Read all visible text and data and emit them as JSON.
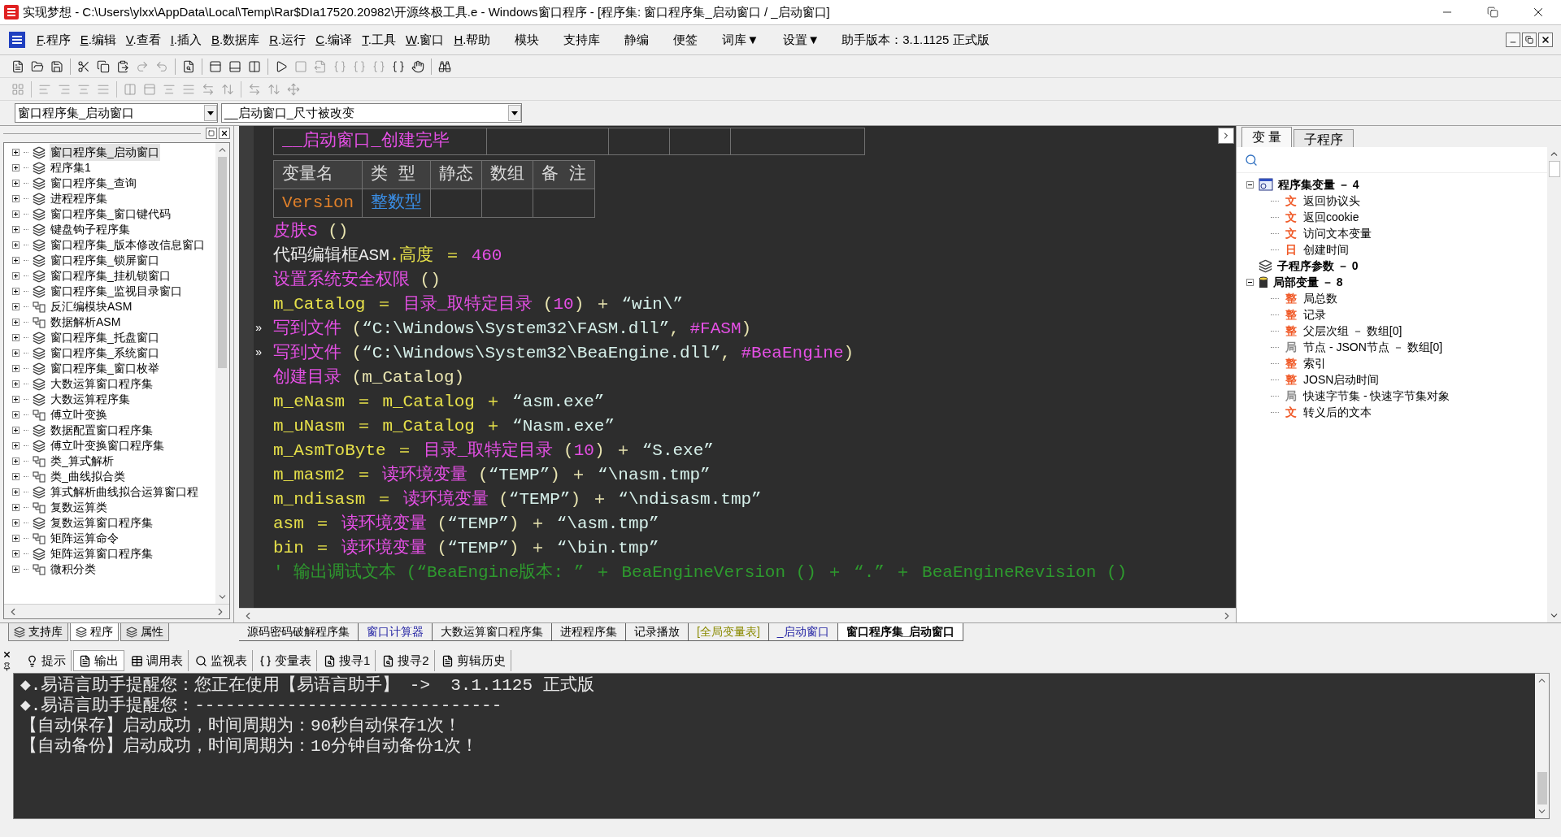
{
  "window": {
    "title": "实现梦想 - C:\\Users\\ylxx\\AppData\\Local\\Temp\\Rar$DIa17520.20982\\开源终极工具.e - Windows窗口程序 - [程序集: 窗口程序集_启动窗口 / _启动窗口]"
  },
  "menu": {
    "items": [
      {
        "label": "F.程序",
        "kind": "main"
      },
      {
        "label": "E.编辑",
        "kind": "main"
      },
      {
        "label": "V.查看",
        "kind": "main"
      },
      {
        "label": "I.插入",
        "kind": "main"
      },
      {
        "label": "B.数据库",
        "kind": "main"
      },
      {
        "label": "R.运行",
        "kind": "main"
      },
      {
        "label": "C.编译",
        "kind": "main"
      },
      {
        "label": "T.工具",
        "kind": "main"
      },
      {
        "label": "W.窗口",
        "kind": "main"
      },
      {
        "label": "H.帮助",
        "kind": "main"
      },
      {
        "label": "模块",
        "kind": "extra"
      },
      {
        "label": "支持库",
        "kind": "extra"
      },
      {
        "label": "静编",
        "kind": "extra"
      },
      {
        "label": "便签",
        "kind": "extra"
      },
      {
        "label": "词库▼",
        "kind": "extra"
      },
      {
        "label": "设置▼",
        "kind": "extra"
      }
    ],
    "version": "助手版本：3.1.1125 正式版"
  },
  "selectors": [
    {
      "value": "窗口程序集_启动窗口"
    },
    {
      "value": "__启动窗口_尺寸被改变"
    }
  ],
  "program_tree": {
    "items": [
      {
        "label": "窗口程序集_启动窗口",
        "kind": "assembly",
        "selected": true
      },
      {
        "label": "程序集1",
        "kind": "assembly",
        "selected": false
      },
      {
        "label": "窗口程序集_查询",
        "kind": "assembly",
        "selected": false
      },
      {
        "label": "进程程序集",
        "kind": "assembly",
        "selected": false
      },
      {
        "label": "窗口程序集_窗口键代码",
        "kind": "assembly",
        "selected": false
      },
      {
        "label": "键盘钩子程序集",
        "kind": "assembly",
        "selected": false
      },
      {
        "label": "窗口程序集_版本修改信息窗口",
        "kind": "assembly",
        "selected": false
      },
      {
        "label": "窗口程序集_锁屏窗口",
        "kind": "assembly",
        "selected": false
      },
      {
        "label": "窗口程序集_挂机锁窗口",
        "kind": "assembly",
        "selected": false
      },
      {
        "label": "窗口程序集_监视目录窗口",
        "kind": "assembly",
        "selected": false
      },
      {
        "label": "反汇编模块ASM",
        "kind": "class",
        "selected": false
      },
      {
        "label": "数据解析ASM",
        "kind": "class",
        "selected": false
      },
      {
        "label": "窗口程序集_托盘窗口",
        "kind": "assembly",
        "selected": false
      },
      {
        "label": "窗口程序集_系统窗口",
        "kind": "assembly",
        "selected": false
      },
      {
        "label": "窗口程序集_窗口枚举",
        "kind": "assembly",
        "selected": false
      },
      {
        "label": "大数运算窗口程序集",
        "kind": "assembly",
        "selected": false
      },
      {
        "label": "大数运算程序集",
        "kind": "assembly",
        "selected": false
      },
      {
        "label": "傅立叶变换",
        "kind": "class",
        "selected": false
      },
      {
        "label": "数据配置窗口程序集",
        "kind": "assembly",
        "selected": false
      },
      {
        "label": "傅立叶变换窗口程序集",
        "kind": "assembly",
        "selected": false
      },
      {
        "label": "类_算式解析",
        "kind": "class",
        "selected": false
      },
      {
        "label": "类_曲线拟合类",
        "kind": "class",
        "selected": false
      },
      {
        "label": "算式解析曲线拟合运算窗口程",
        "kind": "assembly",
        "selected": false
      },
      {
        "label": "复数运算类",
        "kind": "class",
        "selected": false
      },
      {
        "label": "复数运算窗口程序集",
        "kind": "assembly",
        "selected": false
      },
      {
        "label": "矩阵运算命令",
        "kind": "class",
        "selected": false
      },
      {
        "label": "矩阵运算窗口程序集",
        "kind": "assembly",
        "selected": false
      },
      {
        "label": "微积分类",
        "kind": "class",
        "selected": false
      }
    ]
  },
  "panel_tabs": [
    {
      "label": "支持库",
      "selected": false
    },
    {
      "label": "程序",
      "selected": true
    },
    {
      "label": "属性",
      "selected": false
    }
  ],
  "editor": {
    "sub_table": {
      "name": "__启动窗口_创建完毕"
    },
    "var_table": {
      "columns": [
        "变量名",
        "类 型",
        "静态",
        "数组",
        "备 注"
      ],
      "rows": [
        {
          "name": "Version",
          "type": "整数型"
        }
      ]
    },
    "lines": [
      {
        "tokens": [
          {
            "text": "皮肤S",
            "kind": "func"
          },
          {
            "text": " ()",
            "kind": "op"
          }
        ]
      },
      {
        "tokens": [
          {
            "text": "代码编辑框ASM",
            "kind": "plain"
          },
          {
            "text": ".高度 ＝ ",
            "kind": "var"
          },
          {
            "text": "460",
            "kind": "num"
          }
        ]
      },
      {
        "tokens": [
          {
            "text": "设置系统安全权限",
            "kind": "func"
          },
          {
            "text": " ()",
            "kind": "op"
          }
        ]
      },
      {
        "tokens": [
          {
            "text": "m_Catalog ＝ ",
            "kind": "var"
          },
          {
            "text": "目录_取特定目录",
            "kind": "func"
          },
          {
            "text": " (",
            "kind": "op"
          },
          {
            "text": "10",
            "kind": "num"
          },
          {
            "text": ") ＋ ",
            "kind": "op"
          },
          {
            "text": "“win\\”",
            "kind": "str"
          }
        ]
      },
      {
        "marker": "»",
        "tokens": [
          {
            "text": "写到文件",
            "kind": "func"
          },
          {
            "text": " (",
            "kind": "op"
          },
          {
            "text": "“C:\\Windows\\System32\\FASM.dll”",
            "kind": "str"
          },
          {
            "text": ", ",
            "kind": "op"
          },
          {
            "text": "#FASM",
            "kind": "func"
          },
          {
            "text": ")",
            "kind": "op"
          }
        ]
      },
      {
        "marker": "»",
        "tokens": [
          {
            "text": "写到文件",
            "kind": "func"
          },
          {
            "text": " (",
            "kind": "op"
          },
          {
            "text": "“C:\\Windows\\System32\\BeaEngine.dll”",
            "kind": "str"
          },
          {
            "text": ", ",
            "kind": "op"
          },
          {
            "text": "#BeaEngine",
            "kind": "func"
          },
          {
            "text": ")",
            "kind": "op"
          }
        ]
      },
      {
        "tokens": [
          {
            "text": "创建目录",
            "kind": "func"
          },
          {
            "text": " (m_Catalog)",
            "kind": "op"
          }
        ]
      },
      {
        "tokens": [
          {
            "text": "m_eNasm ＝ m_Catalog ＋ ",
            "kind": "var"
          },
          {
            "text": "“asm.exe”",
            "kind": "str"
          }
        ]
      },
      {
        "tokens": [
          {
            "text": "m_uNasm ＝ m_Catalog ＋ ",
            "kind": "var"
          },
          {
            "text": "“Nasm.exe”",
            "kind": "str"
          }
        ]
      },
      {
        "tokens": [
          {
            "text": "m_AsmToByte ＝ ",
            "kind": "var"
          },
          {
            "text": "目录_取特定目录",
            "kind": "func"
          },
          {
            "text": " (",
            "kind": "op"
          },
          {
            "text": "10",
            "kind": "num"
          },
          {
            "text": ") ＋ ",
            "kind": "op"
          },
          {
            "text": "“S.exe”",
            "kind": "str"
          }
        ]
      },
      {
        "tokens": [
          {
            "text": "m_masm2 ＝ ",
            "kind": "var"
          },
          {
            "text": "读环境变量",
            "kind": "func"
          },
          {
            "text": " (",
            "kind": "op"
          },
          {
            "text": "“TEMP”",
            "kind": "str"
          },
          {
            "text": ") ＋ ",
            "kind": "op"
          },
          {
            "text": "“\\nasm.tmp”",
            "kind": "str"
          }
        ]
      },
      {
        "tokens": [
          {
            "text": "m_ndisasm ＝ ",
            "kind": "var"
          },
          {
            "text": "读环境变量",
            "kind": "func"
          },
          {
            "text": " (",
            "kind": "op"
          },
          {
            "text": "“TEMP”",
            "kind": "str"
          },
          {
            "text": ") ＋ ",
            "kind": "op"
          },
          {
            "text": "“\\ndisasm.tmp”",
            "kind": "str"
          }
        ]
      },
      {
        "tokens": [
          {
            "text": "asm ＝ ",
            "kind": "var"
          },
          {
            "text": "读环境变量",
            "kind": "func"
          },
          {
            "text": " (",
            "kind": "op"
          },
          {
            "text": "“TEMP”",
            "kind": "str"
          },
          {
            "text": ") ＋ ",
            "kind": "op"
          },
          {
            "text": "“\\asm.tmp”",
            "kind": "str"
          }
        ]
      },
      {
        "tokens": [
          {
            "text": "bin ＝ ",
            "kind": "var"
          },
          {
            "text": "读环境变量",
            "kind": "func"
          },
          {
            "text": " (",
            "kind": "op"
          },
          {
            "text": "“TEMP”",
            "kind": "str"
          },
          {
            "text": ") ＋ ",
            "kind": "op"
          },
          {
            "text": "“\\bin.tmp”",
            "kind": "str"
          }
        ]
      },
      {
        "tokens": [
          {
            "text": "' 输出调试文本 (“BeaEngine版本: ” ＋ BeaEngineVersion () ＋ “.” ＋ BeaEngineRevision ()",
            "kind": "comment"
          }
        ]
      }
    ]
  },
  "side_panel": {
    "tabs": [
      {
        "label": "变 量",
        "selected": true
      },
      {
        "label": "子程序",
        "selected": false
      }
    ],
    "groups": [
      {
        "label": "程序集变量 － 4",
        "kind": "assembly",
        "expanded": true,
        "children": [
          {
            "type": "文",
            "color": "#f05a28",
            "label": "返回协议头"
          },
          {
            "type": "文",
            "color": "#f05a28",
            "label": "返回cookie"
          },
          {
            "type": "文",
            "color": "#f05a28",
            "label": "访问文本变量"
          },
          {
            "type": "日",
            "color": "#f05a28",
            "label": "创建时间"
          }
        ]
      },
      {
        "label": "子程序参数 － 0",
        "kind": "params"
      },
      {
        "label": "局部变量 － 8",
        "kind": "local",
        "expanded": true,
        "children": [
          {
            "type": "整",
            "color": "#f05a28",
            "label": "局总数"
          },
          {
            "type": "整",
            "color": "#f05a28",
            "label": "记录"
          },
          {
            "type": "整",
            "color": "#f05a28",
            "label": "父层次组 － 数组[0]"
          },
          {
            "type": "局",
            "color": "#8a8a8a",
            "label": "节点 - JSON节点 － 数组[0]"
          },
          {
            "type": "整",
            "color": "#f05a28",
            "label": "索引"
          },
          {
            "type": "整",
            "color": "#f05a28",
            "label": "JOSN启动时间"
          },
          {
            "type": "局",
            "color": "#8a8a8a",
            "label": "快速字节集 - 快速字节集对象"
          },
          {
            "type": "文",
            "color": "#f05a28",
            "label": "转义后的文本"
          }
        ]
      }
    ]
  },
  "editor_tabs": [
    {
      "label": "源码密码破解程序集",
      "selected": false
    },
    {
      "label": "窗口计算器",
      "color": "#1a1aa0",
      "selected": false
    },
    {
      "label": "大数运算窗口程序集",
      "selected": false
    },
    {
      "label": "进程程序集",
      "selected": false
    },
    {
      "label": "记录播放",
      "selected": false
    },
    {
      "label": "[全局变量表]",
      "color": "#8a8a00",
      "selected": false
    },
    {
      "label": "_启动窗口",
      "color": "#1a1aa0",
      "selected": false
    },
    {
      "label": "窗口程序集_启动窗口",
      "selected": true
    }
  ],
  "output_tabs": [
    {
      "label": "提示",
      "selected": false
    },
    {
      "label": "输出",
      "selected": true
    },
    {
      "label": "调用表",
      "selected": false
    },
    {
      "label": "监视表",
      "selected": false
    },
    {
      "label": "变量表",
      "selected": false
    },
    {
      "label": "搜寻1",
      "selected": false
    },
    {
      "label": "搜寻2",
      "selected": false
    },
    {
      "label": "剪辑历史",
      "selected": false
    }
  ],
  "output_lines": [
    "◆.易语言助手提醒您：您正在使用【易语言助手】 ->  3.1.1125 正式版",
    "◆.易语言助手提醒您：------------------------------",
    "【自动保存】启动成功，时间周期为：90秒自动保存1次！",
    "【自动备份】启动成功，时间周期为：10分钟自动备份1次！"
  ]
}
